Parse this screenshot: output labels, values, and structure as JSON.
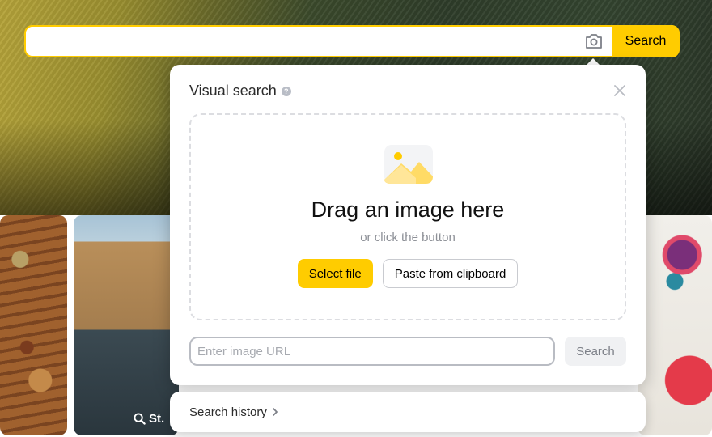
{
  "search": {
    "placeholder": "",
    "button_label": "Search",
    "camera_icon": "camera-icon"
  },
  "visual_search": {
    "title": "Visual search",
    "help_icon": "?",
    "close_icon": "close-icon",
    "drop_heading": "Drag an image here",
    "drop_subtext": "or click the button",
    "select_file_label": "Select file",
    "paste_label": "Paste from clipboard",
    "url_placeholder": "Enter image URL",
    "url_search_label": "Search"
  },
  "history": {
    "label": "Search history",
    "chevron": "›"
  },
  "gallery": {
    "city_caption": "St."
  },
  "colors": {
    "accent": "#ffcc00",
    "border": "#dcdde1",
    "muted_text": "#8c8f96"
  }
}
